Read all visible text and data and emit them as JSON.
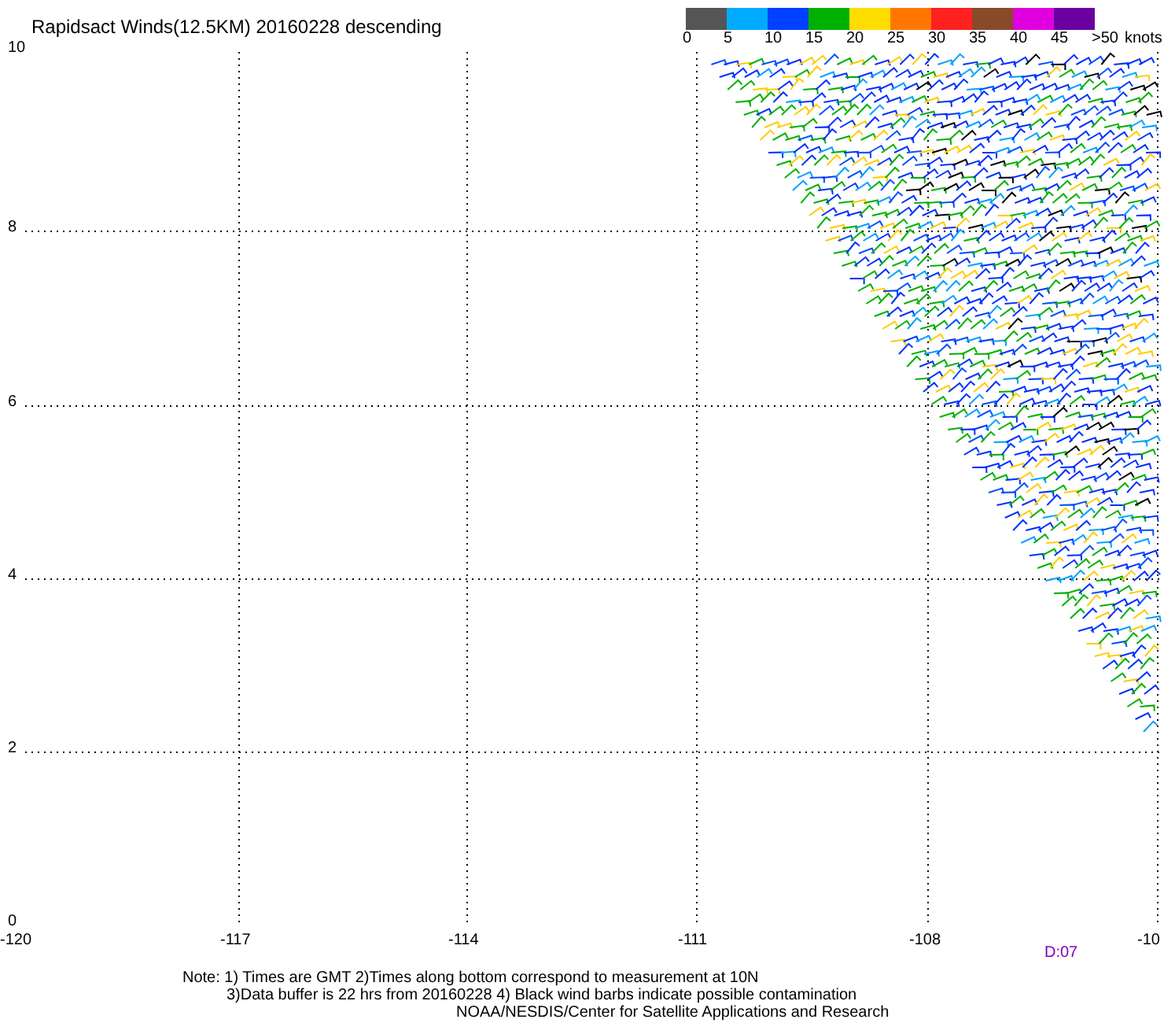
{
  "title": "Rapidsact Winds(12.5KM) 20160228 descending",
  "legend": {
    "segments": [
      {
        "color": "#555555"
      },
      {
        "color": "#00aaff"
      },
      {
        "color": "#0040ff"
      },
      {
        "color": "#00b000"
      },
      {
        "color": "#ffdd00"
      },
      {
        "color": "#ff7700"
      },
      {
        "color": "#ff2020"
      },
      {
        "color": "#8a4a2a"
      },
      {
        "color": "#e000e0"
      },
      {
        "color": "#6a00a0"
      }
    ],
    "labels": [
      "0",
      "5",
      "10",
      "15",
      "20",
      "25",
      "30",
      "35",
      "40",
      "45",
      ">50"
    ],
    "unit": "knots"
  },
  "y_ticks": [
    "10",
    "8",
    "6",
    "4",
    "2",
    "0"
  ],
  "x_ticks": [
    "-120",
    "-117",
    "-114",
    "-111",
    "-108",
    "-10"
  ],
  "time_label": "D:07",
  "notes": [
    "Note: 1) Times are GMT 2)Times along bottom correspond to measurement at 10N",
    "3)Data buffer is 22 hrs from 20160228 4) Black wind barbs indicate possible contamination",
    "NOAA/NESDIS/Center for Satellite Applications and Research"
  ]
}
